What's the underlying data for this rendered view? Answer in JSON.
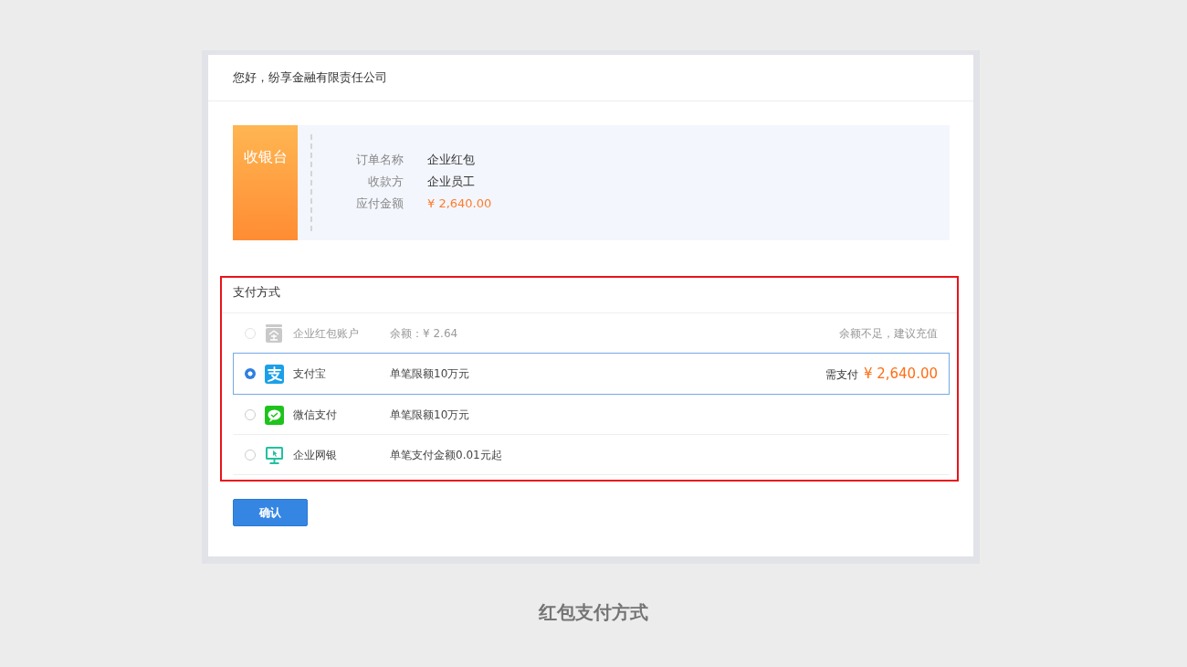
{
  "greeting": "您好，纷享金融有限责任公司",
  "cashier": {
    "title": "收银台",
    "fields": [
      {
        "label": "订单名称",
        "value": "企业红包",
        "kind": "text"
      },
      {
        "label": "收款方",
        "value": "企业员工",
        "kind": "text"
      },
      {
        "label": "应付金额",
        "value": "¥ 2,640.00",
        "kind": "amount"
      }
    ]
  },
  "payment": {
    "title": "支付方式",
    "methods": [
      {
        "kind": "account",
        "name": "企业红包账户",
        "description": "余额：¥ 2.64",
        "note": "余额不足，建议充值",
        "selected": false,
        "disabled": true
      },
      {
        "kind": "alipay",
        "name": "支付宝",
        "description": "单笔限额10万元",
        "pay_label": "需支付",
        "pay_amount": "¥ 2,640.00",
        "selected": true,
        "disabled": false
      },
      {
        "kind": "wechat",
        "name": "微信支付",
        "description": "单笔限额10万元",
        "selected": false,
        "disabled": false
      },
      {
        "kind": "bank",
        "name": "企业网银",
        "description": "单笔支付金额0.01元起",
        "selected": false,
        "disabled": false
      }
    ]
  },
  "confirm_button": "确认",
  "caption": "红包支付方式"
}
